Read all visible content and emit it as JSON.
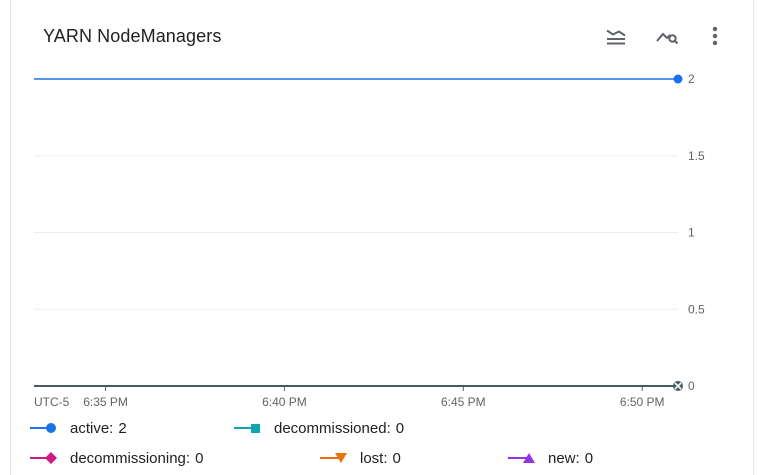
{
  "header": {
    "title": "YARN NodeManagers",
    "icons": [
      "legend-toggle-icon",
      "explore-chart-icon",
      "more-vert-icon"
    ]
  },
  "colors": {
    "active": "#1a73e8",
    "decommissioned": "#12a4af",
    "decommissioning": "#d01884",
    "lost": "#e8710a",
    "new": "#9334e6",
    "grid": "#ebedef",
    "axis": "#5f6368"
  },
  "chart_data": {
    "type": "line",
    "timezone": "UTC-5",
    "x_ticks": [
      "6:35 PM",
      "6:40 PM",
      "6:45 PM",
      "6:50 PM"
    ],
    "y_ticks": [
      "2",
      "1.5",
      "1",
      "0.5",
      "0"
    ],
    "ylim": [
      0,
      2
    ],
    "xlim": [
      "6:33 PM",
      "6:51 PM"
    ],
    "series": [
      {
        "name": "active",
        "values": [
          2,
          2
        ],
        "legend_value": "2"
      },
      {
        "name": "decommissioned",
        "values": [
          0,
          0
        ],
        "legend_value": "0"
      },
      {
        "name": "decommissioning",
        "values": [
          0,
          0
        ],
        "legend_value": "0"
      },
      {
        "name": "lost",
        "values": [
          0,
          0
        ],
        "legend_value": "0"
      },
      {
        "name": "new",
        "values": [
          0,
          0
        ],
        "legend_value": "0"
      }
    ],
    "x": [
      "6:33 PM",
      "6:51 PM"
    ],
    "grid": true,
    "legend_position": "bottom"
  }
}
